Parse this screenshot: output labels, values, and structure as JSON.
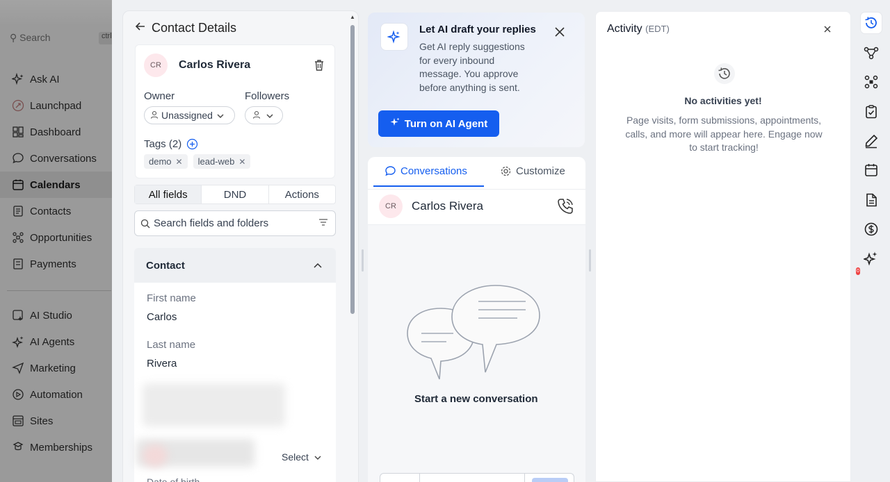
{
  "sidebar": {
    "search_placeholder": "Search",
    "search_kbd": "ctrl",
    "items": [
      {
        "label": "Ask AI",
        "icon": "sparkle-icon"
      },
      {
        "label": "Launchpad",
        "icon": "rocket-icon"
      },
      {
        "label": "Dashboard",
        "icon": "grid-icon"
      },
      {
        "label": "Conversations",
        "icon": "chat-icon"
      },
      {
        "label": "Calendars",
        "icon": "calendar-icon",
        "active": true
      },
      {
        "label": "Contacts",
        "icon": "contacts-icon"
      },
      {
        "label": "Opportunities",
        "icon": "opportunities-icon"
      },
      {
        "label": "Payments",
        "icon": "payments-icon"
      },
      {
        "label": "AI Studio",
        "icon": "ai-studio-icon"
      },
      {
        "label": "AI Agents",
        "icon": "ai-agents-icon"
      },
      {
        "label": "Marketing",
        "icon": "send-icon"
      },
      {
        "label": "Automation",
        "icon": "automation-icon"
      },
      {
        "label": "Sites",
        "icon": "sites-icon"
      },
      {
        "label": "Memberships",
        "icon": "memberships-icon"
      }
    ]
  },
  "contact_details": {
    "title": "Contact Details",
    "initials": "CR",
    "name": "Carlos Rivera",
    "owner_label": "Owner",
    "owner_value": "Unassigned",
    "followers_label": "Followers",
    "tags_label": "Tags (2)",
    "tags": [
      "demo",
      "lead-web"
    ],
    "tabs": [
      "All fields",
      "DND",
      "Actions"
    ],
    "search_placeholder": "Search fields and folders",
    "section_title": "Contact",
    "fields": [
      {
        "label": "First name",
        "value": "Carlos"
      },
      {
        "label": "Last name",
        "value": "Rivera"
      }
    ],
    "select_label": "Select",
    "dob_label": "Date of birth"
  },
  "ai_promo": {
    "title": "Let AI draft your replies",
    "description": "Get AI reply suggestions for every inbound message. You approve before anything is sent.",
    "button_label": "Turn on AI Agent"
  },
  "conversation": {
    "tabs": [
      "Conversations",
      "Customize"
    ],
    "contact_initials": "CR",
    "contact_name": "Carlos Rivera",
    "empty_text": "Start a new conversation"
  },
  "activity": {
    "title": "Activity",
    "timezone": "(EDT)",
    "empty_heading": "No activities yet!",
    "empty_description": "Page visits, form submissions, appointments, calls, and more will appear here. Engage now to start tracking!"
  },
  "right_rail": {
    "icons": [
      "activity-clock-icon",
      "workflow-icon",
      "apps-icon",
      "tasks-icon",
      "notes-icon",
      "appointments-icon",
      "documents-icon",
      "payments-icon",
      "ai-sparkle-icon"
    ],
    "badge": "0"
  },
  "colors": {
    "accent": "#155eef",
    "sidebar_overlay": "#9a9a9a"
  }
}
